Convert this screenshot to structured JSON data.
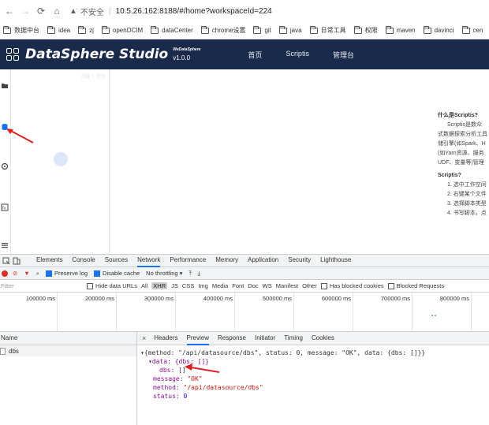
{
  "browser": {
    "insecure_label": "不安全",
    "url": "10.5.26.162:8188/#/home?workspaceId=224",
    "bookmarks": [
      "数据中台",
      "idea",
      "zj",
      "openDCIM",
      "dataCenter",
      "chrome设置",
      "git",
      "java",
      "日常工具",
      "权限",
      "maven",
      "davinci",
      "cen"
    ]
  },
  "app": {
    "title": "DataSphere Studio",
    "sub_brand": "WeDataSphere",
    "version": "v1.0.0",
    "nav": [
      "首页",
      "Scriptis",
      "管理台"
    ],
    "sidebar_placeholder": "请输入 搜索"
  },
  "intro": {
    "heading1": "什么是Scriptis?",
    "lines1": [
      "Scriptis是数众",
      "式数据探索分析工具",
      "储引擎(如Spark、H",
      "(如Yarn资源、服务",
      "UDF、变量等)管理"
    ],
    "heading2": "Scriptis?",
    "lines2": [
      "1. 选中工作空间",
      "2. 右键某个文件",
      "3. 选择脚本类型",
      "4. 书写脚本，点"
    ]
  },
  "devtools": {
    "tabs": [
      "Elements",
      "Console",
      "Sources",
      "Network",
      "Performance",
      "Memory",
      "Application",
      "Security",
      "Lighthouse"
    ],
    "active_tab": "Network",
    "toolbar": {
      "preserve_log": "Preserve log",
      "disable_cache": "Disable cache",
      "throttling": "No throttling"
    },
    "filter": {
      "placeholder": "Filter",
      "hide_data_urls": "Hide data URLs",
      "types": [
        "All",
        "XHR",
        "JS",
        "CSS",
        "Img",
        "Media",
        "Font",
        "Doc",
        "WS",
        "Manifest",
        "Other"
      ],
      "active_type": "XHR",
      "blocked_cookies": "Has blocked cookies",
      "blocked_requests": "Blocked Requests"
    },
    "timeline": [
      "100000 ms",
      "200000 ms",
      "300000 ms",
      "400000 ms",
      "500000 ms",
      "600000 ms",
      "700000 ms",
      "800000 ms"
    ],
    "name_header": "Name",
    "requests": [
      "dbs"
    ],
    "detail_tabs": [
      "Headers",
      "Preview",
      "Response",
      "Initiator",
      "Timing",
      "Cookies"
    ],
    "active_detail_tab": "Preview",
    "preview": {
      "line1": "{method: \"/api/datasource/dbs\", status: 0, message: \"OK\", data: {dbs: []}}",
      "data_label": "data: {dbs: []}",
      "dbs_key": "dbs:",
      "dbs_val": "[]",
      "message_key": "message:",
      "message_val": "\"OK\"",
      "method_key": "method:",
      "method_val": "\"/api/datasource/dbs\"",
      "status_key": "status:",
      "status_val": "0"
    }
  },
  "colors": {
    "header_bg": "#1a2a4a",
    "accent": "#1a73e8",
    "arrow": "#e02020"
  }
}
